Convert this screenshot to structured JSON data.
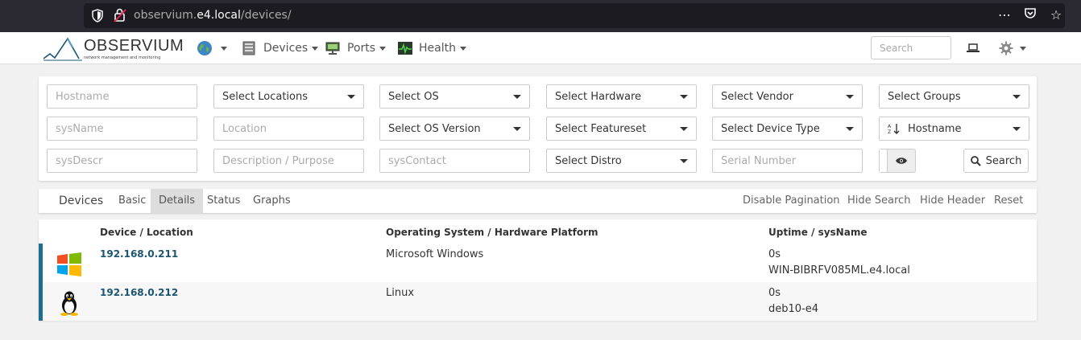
{
  "browser": {
    "url_host": "observium.e4.local",
    "url_path": "/devices/",
    "url_prefix": "observium."
  },
  "navbar": {
    "logo_text": "OBSERVIUM",
    "logo_sub": "network management and monitoring",
    "items": [
      {
        "label": "Devices",
        "icon": "server-icon"
      },
      {
        "label": "Ports",
        "icon": "network-port-icon"
      },
      {
        "label": "Health",
        "icon": "heartbeat-icon"
      }
    ],
    "search_placeholder": "Search"
  },
  "filters": {
    "row1": [
      {
        "kind": "input",
        "placeholder": "Hostname"
      },
      {
        "kind": "select",
        "label": "Select Locations"
      },
      {
        "kind": "select",
        "label": "Select OS"
      },
      {
        "kind": "select",
        "label": "Select Hardware"
      },
      {
        "kind": "select",
        "label": "Select Vendor"
      },
      {
        "kind": "select",
        "label": "Select Groups"
      }
    ],
    "row2": [
      {
        "kind": "input",
        "placeholder": "sysName"
      },
      {
        "kind": "input",
        "placeholder": "Location"
      },
      {
        "kind": "select",
        "label": "Select OS Version"
      },
      {
        "kind": "select",
        "label": "Select Featureset"
      },
      {
        "kind": "select",
        "label": "Select Device Type"
      },
      {
        "kind": "select",
        "label": "Hostname"
      }
    ],
    "row3": [
      {
        "kind": "input",
        "placeholder": "sysDescr"
      },
      {
        "kind": "input",
        "placeholder": "Description / Purpose"
      },
      {
        "kind": "input",
        "placeholder": "sysContact"
      },
      {
        "kind": "select",
        "label": "Select Distro"
      },
      {
        "kind": "input",
        "placeholder": "Serial Number"
      }
    ],
    "search_button": "Search"
  },
  "tabs": {
    "brand": "Devices",
    "items": [
      "Basic",
      "Details",
      "Status",
      "Graphs"
    ],
    "active": "Details",
    "right": [
      "Disable Pagination",
      "Hide Search",
      "Hide Header",
      "Reset"
    ]
  },
  "table": {
    "headers": [
      "Device / Location",
      "Operating System / Hardware Platform",
      "Uptime / sysName"
    ],
    "rows": [
      {
        "device": "192.168.0.211",
        "os": "Microsoft Windows",
        "uptime": "0s",
        "sysname": "WIN-BIBRFV085ML.e4.local",
        "icon": "windows-icon"
      },
      {
        "device": "192.168.0.212",
        "os": "Linux",
        "uptime": "0s",
        "sysname": "deb10-e4",
        "icon": "linux-tux-icon"
      }
    ]
  },
  "colors": {
    "status_bar": "#1f6e8f",
    "link": "#1b5571",
    "browser_chrome": "#2b2a33"
  }
}
